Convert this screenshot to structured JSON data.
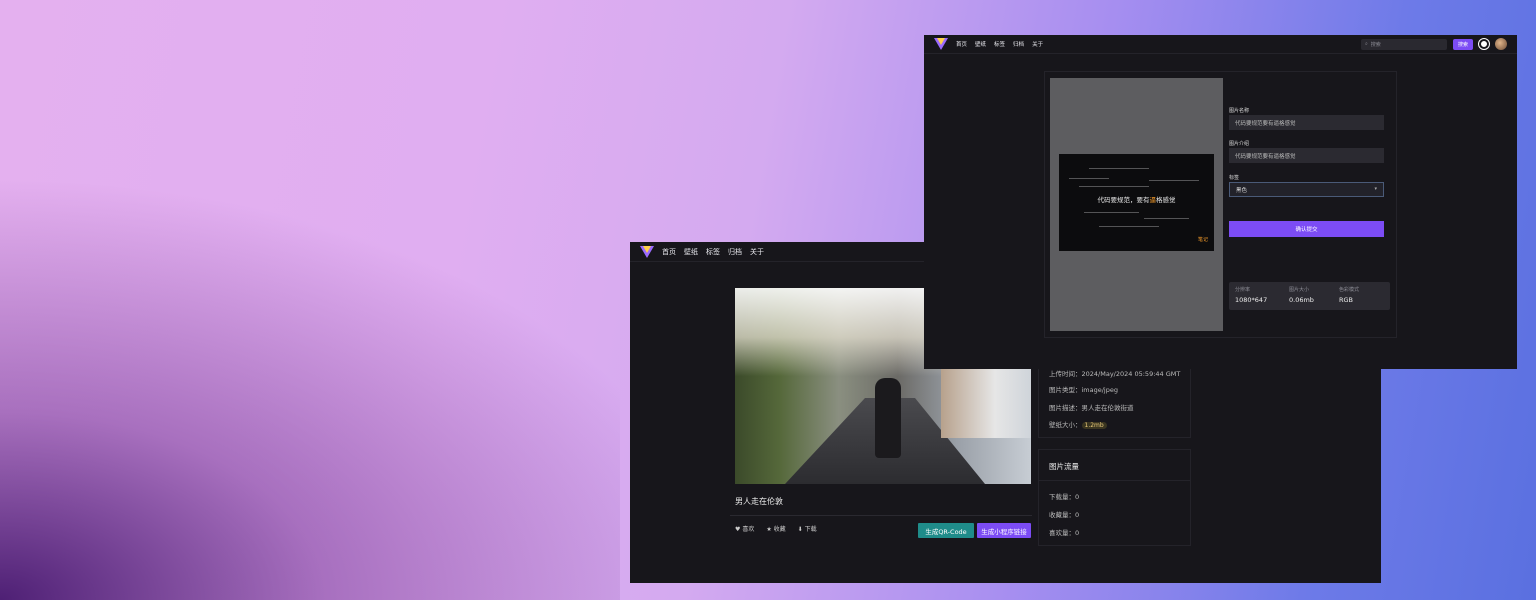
{
  "back_window": {
    "nav": [
      "首页",
      "壁纸",
      "标签",
      "归档",
      "关于"
    ],
    "photo_title": "男人走在伦敦",
    "actions": [
      {
        "icon": "heart-icon",
        "label": "喜欢"
      },
      {
        "icon": "star-icon",
        "label": "收藏"
      },
      {
        "icon": "download-icon",
        "label": "下载"
      }
    ],
    "btn_qr": "生成QR-Code",
    "btn_mini": "生成小程序链接",
    "info": {
      "upload_time": "上传时间：2024/May/2024 05:59:44 GMT",
      "mime": "图片类型：image/jpeg",
      "desc": "图片描述：男人走在伦敦街道",
      "size_label": "壁纸大小：",
      "size_value": "1.2mb"
    },
    "stats": {
      "title": "图片流量",
      "download": "下载量：0",
      "favorite": "收藏量：0",
      "like": "喜欢量：0"
    }
  },
  "front_window": {
    "nav": [
      "首页",
      "壁纸",
      "标签",
      "归档",
      "关于"
    ],
    "search_placeholder": "搜索",
    "search_button": "搜索",
    "wall_text_a": "代码要规范，要有",
    "wall_text_b": "逼",
    "wall_text_c": "格感觉",
    "wall_mark": "笔记",
    "name_label": "图片名称",
    "name_value": "代码要规范要有逼格感觉",
    "desc_label": "图片介绍",
    "desc_value": "代码要规范要有逼格感觉",
    "tag_label": "标签",
    "tag_value": "黑色",
    "submit": "确认提交",
    "meta": [
      {
        "k": "分辨率",
        "v": "1080*647"
      },
      {
        "k": "图片大小",
        "v": "0.06mb"
      },
      {
        "k": "色彩模式",
        "v": "RGB"
      }
    ]
  }
}
